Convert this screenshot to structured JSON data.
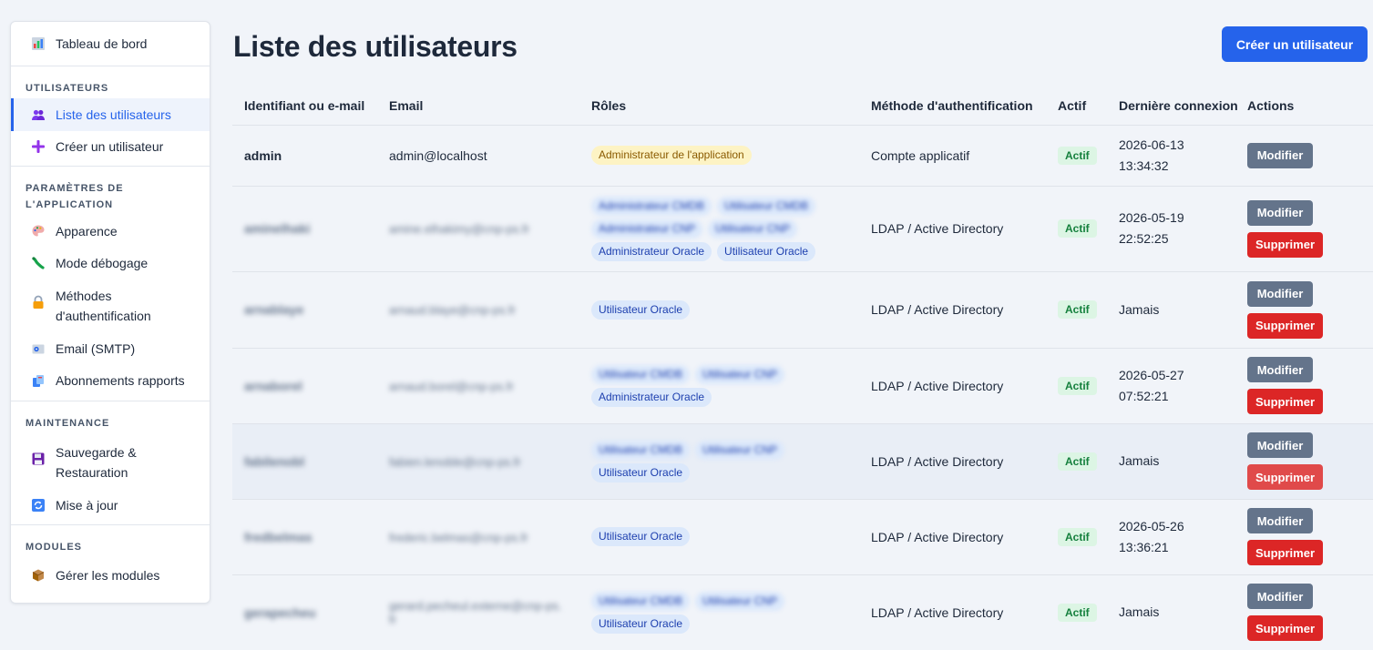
{
  "page": {
    "title": "Liste des utilisateurs",
    "create_button": "Créer un utilisateur"
  },
  "sidebar": {
    "dashboard": {
      "label": "Tableau de bord",
      "icon": "bar-chart-icon"
    },
    "sections": [
      {
        "heading": "UTILISATEURS",
        "items": [
          {
            "label": "Liste des utilisateurs",
            "icon": "users-icon",
            "active": true
          },
          {
            "label": "Créer un utilisateur",
            "icon": "plus-icon"
          }
        ]
      },
      {
        "heading": "PARAMÈTRES DE L'APPLICATION",
        "items": [
          {
            "label": "Apparence",
            "icon": "palette-icon"
          },
          {
            "label": "Mode débogage",
            "icon": "bug-icon"
          },
          {
            "label": "Méthodes d'authentification",
            "icon": "lock-icon"
          },
          {
            "label": "Email (SMTP)",
            "icon": "email-icon"
          },
          {
            "label": "Abonnements rapports",
            "icon": "reports-icon"
          }
        ]
      },
      {
        "heading": "MAINTENANCE",
        "items": [
          {
            "label": "Sauvegarde & Restauration",
            "icon": "floppy-disk-icon"
          },
          {
            "label": "Mise à jour",
            "icon": "refresh-icon"
          }
        ]
      },
      {
        "heading": "MODULES",
        "items": [
          {
            "label": "Gérer les modules",
            "icon": "package-icon"
          }
        ]
      }
    ]
  },
  "table": {
    "columns": [
      "Identifiant ou e-mail",
      "Email",
      "Rôles",
      "Méthode d'authentification",
      "Actif",
      "Dernière connexion",
      "Actions"
    ],
    "edit_label": "Modifier",
    "delete_label": "Supprimer",
    "rows": [
      {
        "login": "admin",
        "email": "admin@localhost",
        "blurred": false,
        "roles": [
          {
            "name": "Administrateur de l'application",
            "type": "admin"
          }
        ],
        "auth": "Compte applicatif",
        "active": "Actif",
        "last": [
          "2026-06-13",
          "13:34:32"
        ],
        "deletable": false
      },
      {
        "login": "aminelhaki",
        "email": "amine.elhakimy@cnp-ps.fr",
        "blurred": true,
        "roles": [
          {
            "name": "Administrateur CMDB",
            "blurred": true
          },
          {
            "name": "Utilisateur CMDB",
            "blurred": true
          },
          {
            "name": "Administrateur CNP",
            "blurred": true
          },
          {
            "name": "Utilisateur CNP",
            "blurred": true
          },
          {
            "name": "Administrateur Oracle"
          },
          {
            "name": "Utilisateur Oracle"
          }
        ],
        "auth": "LDAP / Active Directory",
        "active": "Actif",
        "last": [
          "2026-05-19",
          "22:52:25"
        ],
        "deletable": true
      },
      {
        "login": "arnablaye",
        "email": "arnaud.blaye@cnp-ps.fr",
        "blurred": true,
        "roles": [
          {
            "name": "Utilisateur Oracle"
          }
        ],
        "auth": "LDAP / Active Directory",
        "active": "Actif",
        "last": [
          "Jamais"
        ],
        "deletable": true
      },
      {
        "login": "arnaborel",
        "email": "arnaud.borel@cnp-ps.fr",
        "blurred": true,
        "roles": [
          {
            "name": "Utilisateur CMDB",
            "blurred": true
          },
          {
            "name": "Utilisateur CNP",
            "blurred": true
          },
          {
            "name": "Administrateur Oracle"
          }
        ],
        "auth": "LDAP / Active Directory",
        "active": "Actif",
        "last": [
          "2026-05-27",
          "07:52:21"
        ],
        "deletable": true
      },
      {
        "login": "fabilenobl",
        "email": "fabien.lenoble@cnp-ps.fr",
        "blurred": true,
        "highlight": true,
        "roles": [
          {
            "name": "Utilisateur CMDB",
            "blurred": true
          },
          {
            "name": "Utilisateur CNP",
            "blurred": true
          },
          {
            "name": "Utilisateur Oracle"
          }
        ],
        "auth": "LDAP / Active Directory",
        "active": "Actif",
        "last": [
          "Jamais"
        ],
        "deletable": true
      },
      {
        "login": "fredbelmas",
        "email": "frederic.belmas@cnp-ps.fr",
        "blurred": true,
        "roles": [
          {
            "name": "Utilisateur Oracle"
          }
        ],
        "auth": "LDAP / Active Directory",
        "active": "Actif",
        "last": [
          "2026-05-26",
          "13:36:21"
        ],
        "deletable": true
      },
      {
        "login": "gerapecheu",
        "email": "gerard.pecheul.externe@cnp-ps.fr",
        "blurred": true,
        "roles": [
          {
            "name": "Utilisateur CMDB",
            "blurred": true
          },
          {
            "name": "Utilisateur CNP",
            "blurred": true
          },
          {
            "name": "Utilisateur Oracle"
          }
        ],
        "auth": "LDAP / Active Directory",
        "active": "Actif",
        "last": [
          "Jamais"
        ],
        "deletable": true
      }
    ]
  },
  "colors": {
    "accent": "#2563eb",
    "edit": "#64748b",
    "delete": "#dc2626",
    "active_badge": "#15803d",
    "admin_role": "#8a5a00"
  }
}
